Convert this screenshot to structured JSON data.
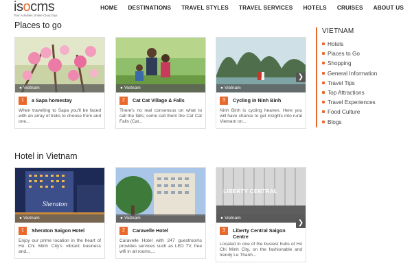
{
  "header": {
    "logo_text_pre": "is",
    "logo_text_o": "o",
    "logo_text_post": "cms",
    "logo_tagline": "Tour Activities Online Cloud Sys",
    "nav": [
      "HOME",
      "DESTINATIONS",
      "TRAVEL STYLES",
      "TRAVEL SERVICES",
      "HOTELS",
      "CRUISES",
      "ABOUT US"
    ]
  },
  "places": {
    "title": "Places to go",
    "cards": [
      {
        "num": "1",
        "location": "Vietnam",
        "title": "a Sapa homestay",
        "desc": "When travelling to Sapa you'll be faced with an array of treks to choose from and one..."
      },
      {
        "num": "2",
        "location": "Vietnam",
        "title": "Cat Cat Village & Falls",
        "desc": "There's no real consensus on what to call the falls; some call them the Cat Cat Falls (Cat..."
      },
      {
        "num": "3",
        "location": "Vietnam",
        "title": "Cycling in Ninh Binh",
        "desc": "Ninh Binh is cycling heaven. Here you will have chance to get insights into rural Vietnam on..."
      }
    ]
  },
  "hotels": {
    "title": "Hotel in Vietnam",
    "cards": [
      {
        "num": "1",
        "location": "Vietnam",
        "title": "Sheraton Saigon Hotel",
        "desc": "Enjoy our prime location in the heart of Ho Chi Minh City's vibrant business and...",
        "sign": "Sheraton"
      },
      {
        "num": "2",
        "location": "Vietnam",
        "title": "Caravelle Hotel",
        "desc": "Caravelle Hotel with 247 guestrooms provides services such as LED TV, free wifi in all rooms,..."
      },
      {
        "num": "3",
        "location": "Vietnam",
        "title": "Liberty Central Saigon Centre",
        "desc": "Located in one of the busiest hubs of Ho Chi Minh City, on the fashionable and trendy Le Thanh...",
        "sign": "LIBERTY CENTRAL"
      }
    ]
  },
  "sidebar": {
    "title": "VIETNAM",
    "items": [
      "Hotels",
      "Places to Go",
      "Shopping",
      "General Information",
      "Travel Tips",
      "Top Attractions",
      "Travel Experiences",
      "Food Culture",
      "Blogs"
    ]
  },
  "arrows": {
    "next": "❯"
  },
  "colors": {
    "accent": "#e8692b",
    "location_bar": "#5a5a5a"
  }
}
